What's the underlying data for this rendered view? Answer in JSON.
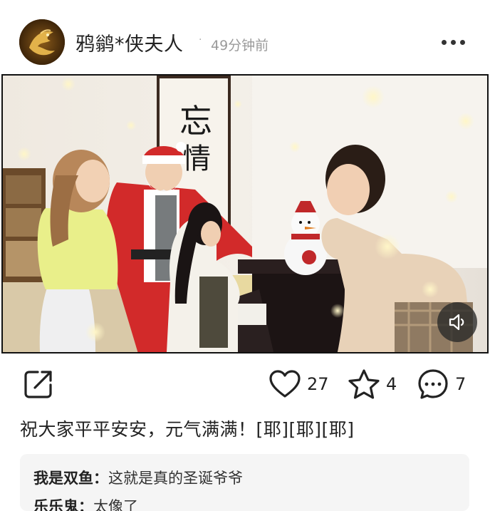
{
  "post": {
    "author": {
      "name": "鸦鹟*侠夫人",
      "avatar_icon": "golden-phoenix-avatar"
    },
    "separator": "·",
    "time_ago": "49分钟前",
    "more_icon": "more-horizontal-icon",
    "video": {
      "calligraphy": "忘 情",
      "mute_icon": "speaker-muted-icon"
    },
    "actions": {
      "share_icon": "share-icon",
      "like_icon": "heart-icon",
      "like_count": "27",
      "favorite_icon": "star-icon",
      "favorite_count": "4",
      "comment_icon": "comment-bubble-icon",
      "comment_count": "7"
    },
    "caption": "祝大家平平安安，元气满满！[耶][耶][耶]",
    "comments": [
      {
        "user": "我是双鱼",
        "sep": "：",
        "text": "这就是真的圣诞爷爷"
      },
      {
        "user": "乐乐鬼",
        "sep": "：",
        "text": "太像了"
      }
    ]
  },
  "colors": {
    "santa_red": "#d22a2a",
    "sweater_yellow": "#e9ef8a",
    "mute_bg": "#3a3a3a"
  }
}
